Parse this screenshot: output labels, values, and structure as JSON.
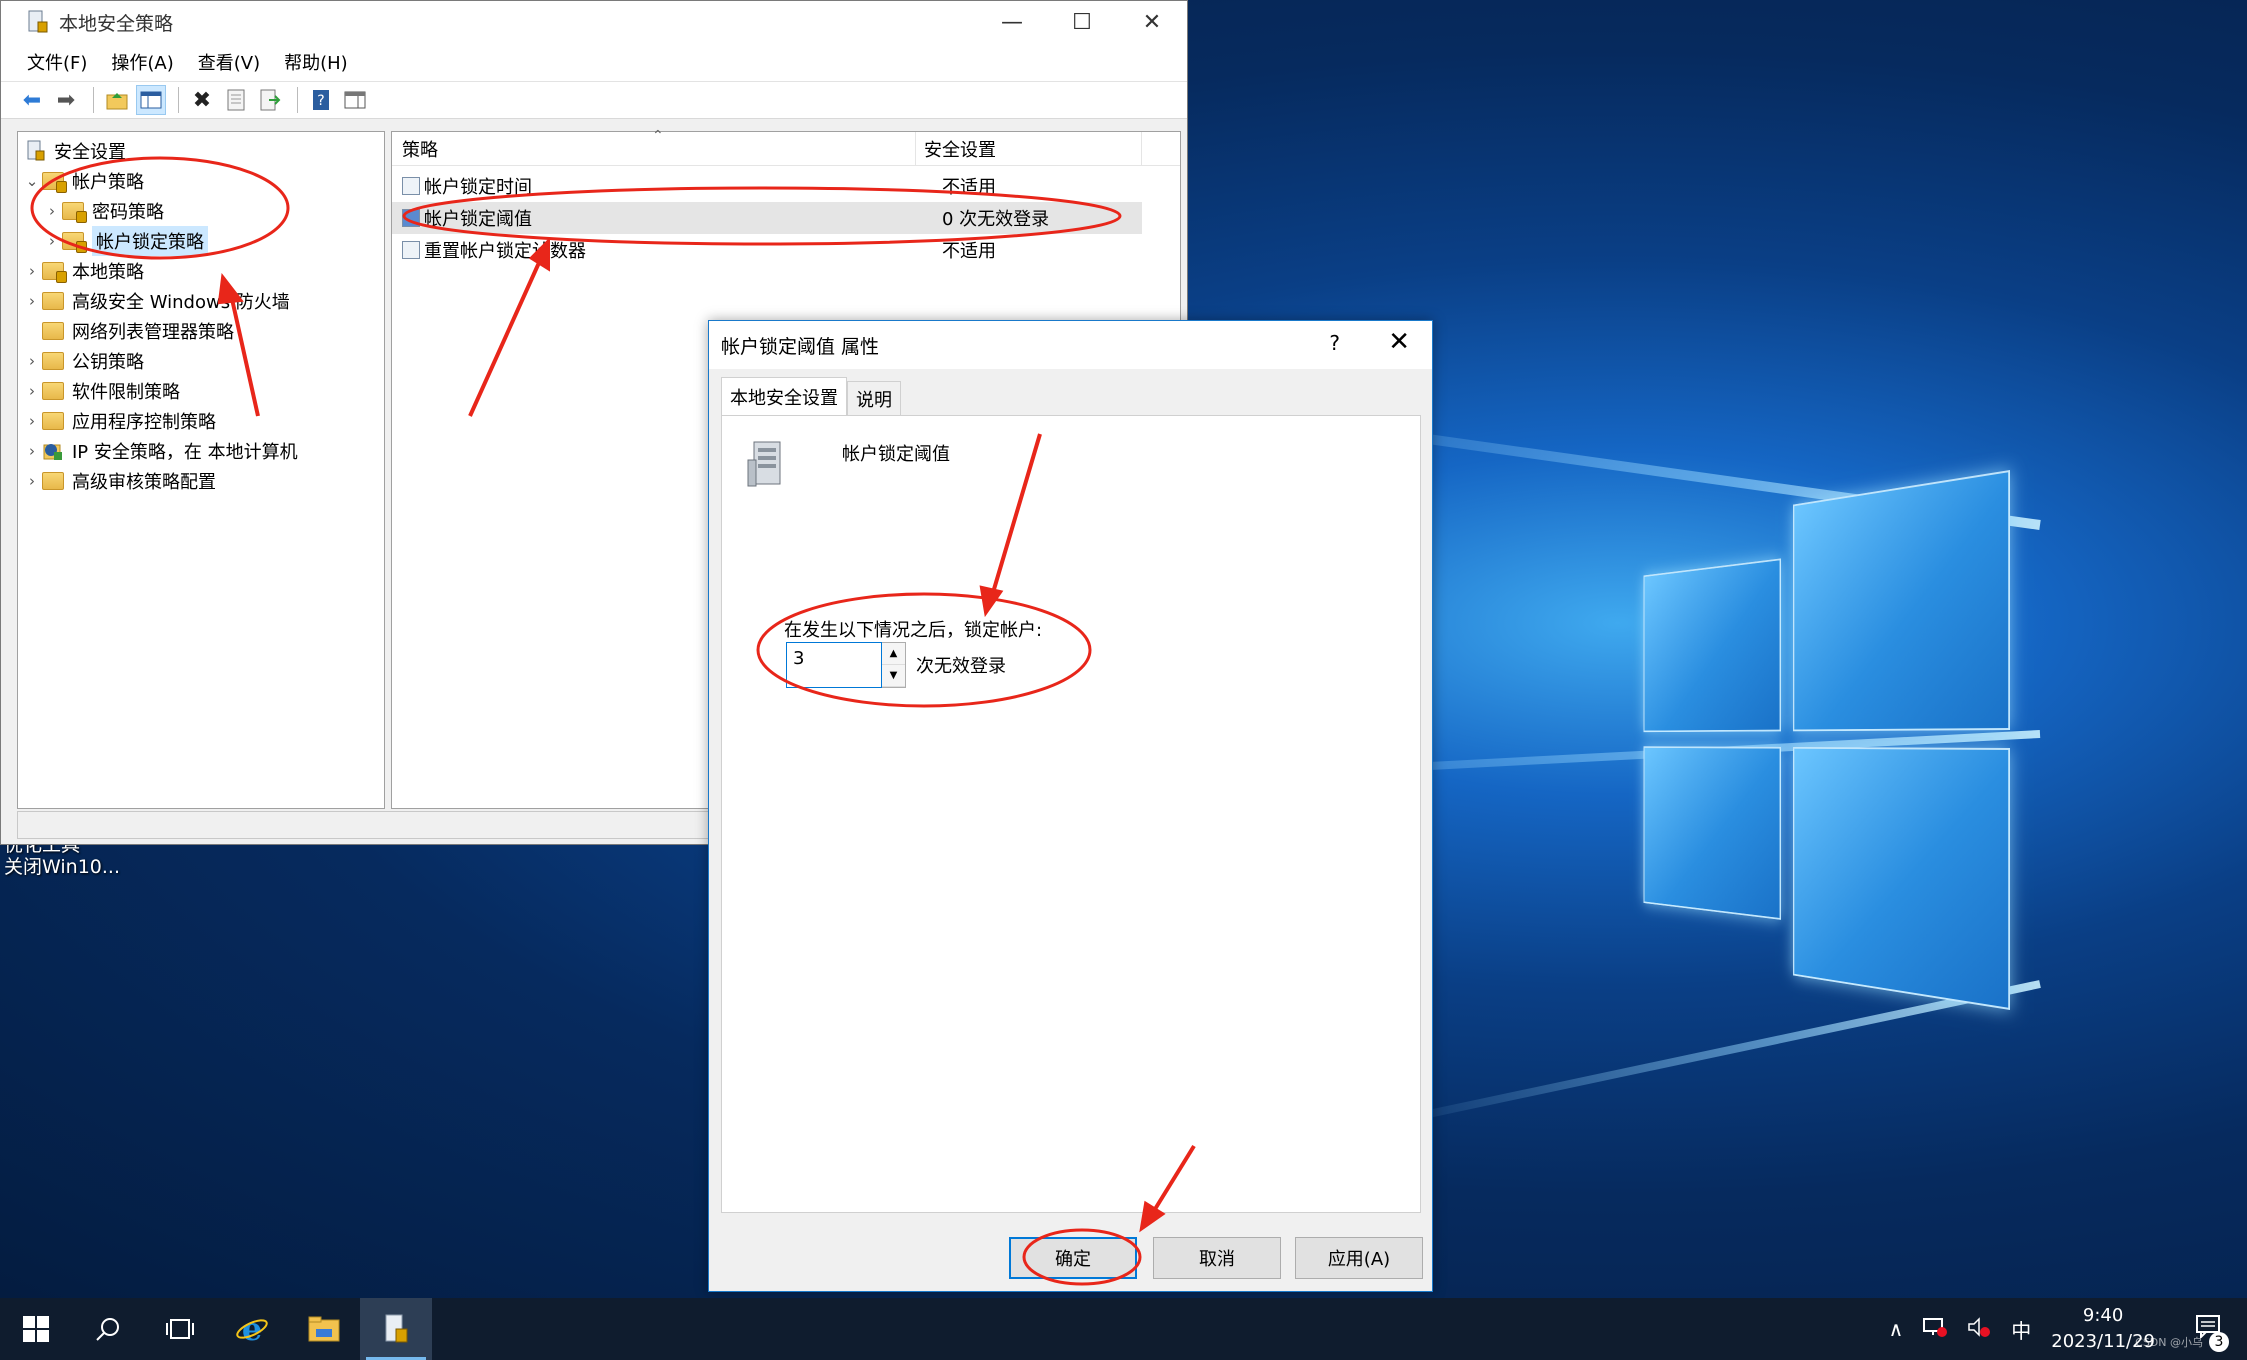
{
  "desktop": {
    "labels": [
      "优化工具",
      "关闭Win10..."
    ]
  },
  "mmc": {
    "title": "本地安全策略",
    "window_controls": {
      "minimize": "—",
      "maximize": "☐",
      "close": "✕"
    },
    "menu": [
      "文件(F)",
      "操作(A)",
      "查看(V)",
      "帮助(H)"
    ],
    "tree": {
      "root": "安全设置",
      "items": [
        {
          "label": "帐户策略",
          "expanded": true
        },
        {
          "label": "密码策略"
        },
        {
          "label": "帐户锁定策略",
          "selected": true
        },
        {
          "label": "本地策略"
        },
        {
          "label": "高级安全 Windows 防火墙"
        },
        {
          "label": "网络列表管理器策略"
        },
        {
          "label": "公钥策略"
        },
        {
          "label": "软件限制策略"
        },
        {
          "label": "应用程序控制策略"
        },
        {
          "label": "IP 安全策略，在 本地计算机"
        },
        {
          "label": "高级审核策略配置"
        }
      ]
    },
    "list": {
      "col_policy": "策略",
      "col_setting": "安全设置",
      "rows": [
        {
          "name": "帐户锁定时间",
          "value": "不适用"
        },
        {
          "name": "帐户锁定阈值",
          "value": "0 次无效登录",
          "selected": true
        },
        {
          "name": "重置帐户锁定计数器",
          "value": "不适用"
        }
      ]
    }
  },
  "dialog": {
    "title": "帐户锁定阈值 属性",
    "help": "?",
    "close": "✕",
    "tabs": [
      "本地安全设置",
      "说明"
    ],
    "policy_name": "帐户锁定阈值",
    "lock_label": "在发生以下情况之后，锁定帐户:",
    "threshold_value": "3",
    "unit": "次无效登录",
    "buttons": {
      "ok": "确定",
      "cancel": "取消",
      "apply": "应用(A)"
    }
  },
  "taskbar": {
    "ime": "中",
    "time": "9:40",
    "date": "2023/11/29",
    "notification_count": "3",
    "watermark": "CSDN @小乌"
  },
  "colors": {
    "annotation_red": "#e8261a",
    "selection_blue": "#cce8ff",
    "accent": "#0078d7"
  }
}
